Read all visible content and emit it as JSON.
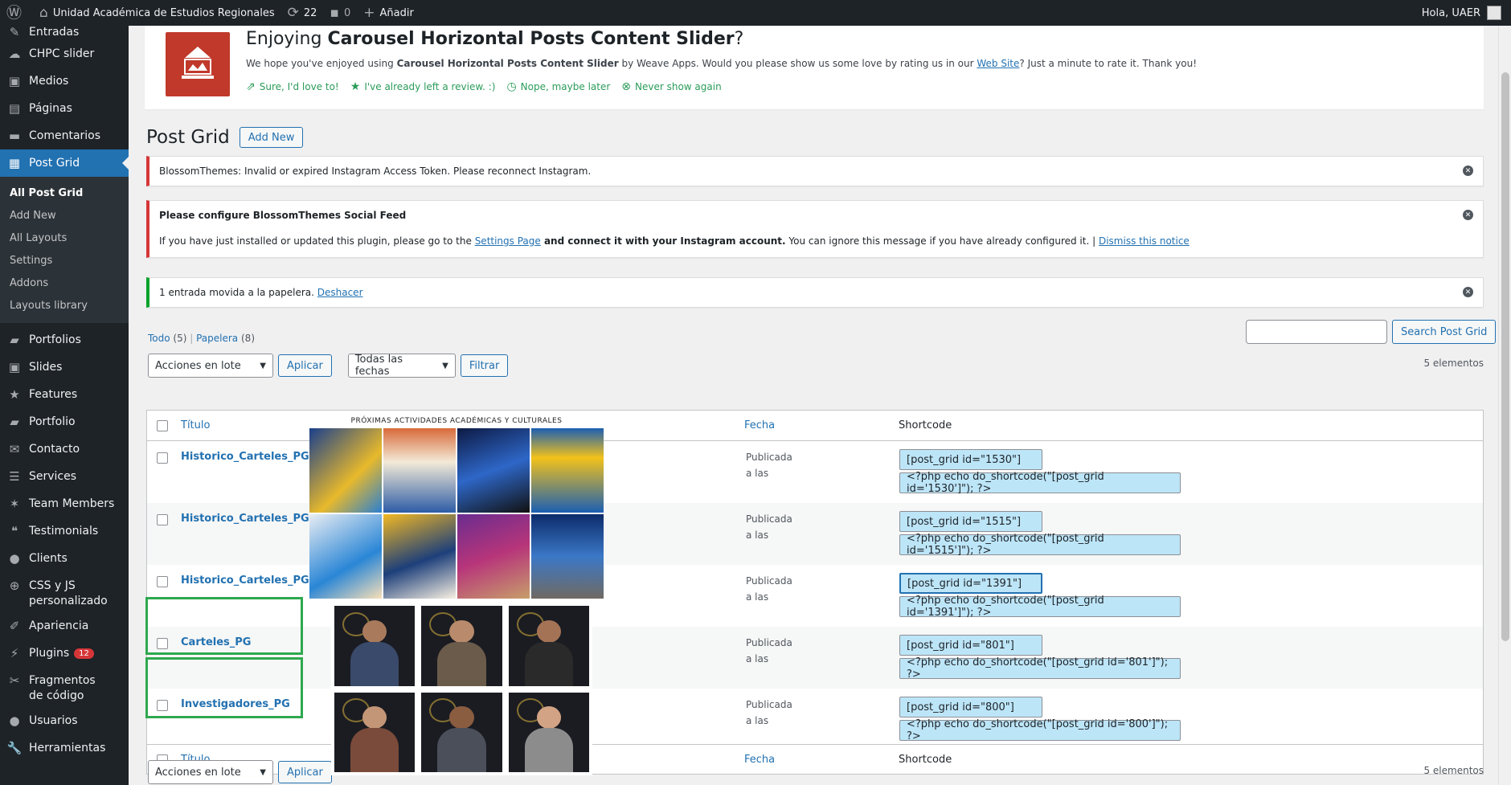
{
  "adminbar": {
    "site_name": "Unidad Académica de Estudios Regionales",
    "updates": "22",
    "comments": "0",
    "new_label": "Añadir",
    "greeting": "Hola, UAER"
  },
  "sidebar": {
    "items": [
      {
        "label": "Entradas",
        "icon": "pin-icon"
      },
      {
        "label": "CHPC slider",
        "icon": "slider-icon"
      },
      {
        "label": "Medios",
        "icon": "media-icon"
      },
      {
        "label": "Páginas",
        "icon": "pages-icon"
      },
      {
        "label": "Comentarios",
        "icon": "comment-icon"
      },
      {
        "label": "Post Grid",
        "icon": "grid-icon"
      }
    ],
    "submenu": [
      "All Post Grid",
      "Add New",
      "All Layouts",
      "Settings",
      "Addons",
      "Layouts library"
    ],
    "items2": [
      {
        "label": "Portfolios"
      },
      {
        "label": "Slides"
      },
      {
        "label": "Features"
      },
      {
        "label": "Portfolio"
      },
      {
        "label": "Contacto"
      },
      {
        "label": "Services"
      },
      {
        "label": "Team Members"
      },
      {
        "label": "Testimonials"
      },
      {
        "label": "Clients"
      },
      {
        "label": "CSS y JS personalizado"
      },
      {
        "label": "Apariencia"
      },
      {
        "label": "Plugins",
        "badge": "12"
      },
      {
        "label": "Fragmentos de código"
      },
      {
        "label": "Usuarios"
      },
      {
        "label": "Herramientas"
      }
    ]
  },
  "rate_notice": {
    "title_prefix": "Enjoying ",
    "title_bold": "Carousel Horizontal Posts Content Slider",
    "title_suffix": "?",
    "text_1": "We hope you've enjoyed using ",
    "text_bold": "Carousel Horizontal Posts Content Slider",
    "text_2": " by Weave Apps. Would you please show us some love by rating us in our ",
    "text_link": "Web Site",
    "text_3": "? Just a minute to rate it. Thank you!",
    "actions": [
      "Sure, I'd love to!",
      "I've already left a review. :)",
      "Nope, maybe later",
      "Never show again"
    ]
  },
  "page": {
    "title": "Post Grid",
    "add_new": "Add New"
  },
  "notices": {
    "n1": "BlossomThemes: Invalid or expired Instagram Access Token. Please reconnect Instagram.",
    "n2_title": "Please configure BlossomThemes Social Feed",
    "n2_a": "If you have just installed or updated this plugin, please go to the ",
    "n2_link": "Settings Page",
    "n2_b": " and connect it with your Instagram account.",
    "n2_c": " You can ignore this message if you have already configured it. | ",
    "n2_dismiss": "Dismiss this notice",
    "n3_text": "1 entrada movida a la papelera. ",
    "n3_link": "Deshacer"
  },
  "views": {
    "all": "Todo",
    "all_count": "(5)",
    "trash": "Papelera",
    "trash_count": "(8)"
  },
  "search": {
    "button": "Search Post Grid",
    "value": ""
  },
  "tablenav": {
    "bulk": "Acciones en lote",
    "apply": "Aplicar",
    "dates": "Todas las fechas",
    "filter": "Filtrar",
    "count": "5 elementos"
  },
  "table": {
    "col_title": "Título",
    "col_date": "Fecha",
    "col_shortcode": "Shortcode",
    "rows": [
      {
        "title": "Historico_Carteles_PG – 2",
        "status": "Publicada",
        "when": "a las",
        "sc": "[post_grid id=\"1530\"]",
        "php": "<?php echo do_shortcode(\"[post_grid id='1530']\"); ?>"
      },
      {
        "title": "Historico_Carteles_PG – 2",
        "status": "Publicada",
        "when": "a las",
        "sc": "[post_grid id=\"1515\"]",
        "php": "<?php echo do_shortcode(\"[post_grid id='1515']\"); ?>"
      },
      {
        "title": "Historico_Carteles_PG",
        "status": "Publicada",
        "when": "a las",
        "sc": "[post_grid id=\"1391\"]",
        "php": "<?php echo do_shortcode(\"[post_grid id='1391']\"); ?>"
      },
      {
        "title": "Carteles_PG",
        "status": "Publicada",
        "when": "a las",
        "sc": "[post_grid id=\"801\"]",
        "php": "<?php echo do_shortcode(\"[post_grid id='801']\"); ?>"
      },
      {
        "title": "Investigadores_PG",
        "status": "Publicada",
        "when": "a las",
        "sc": "[post_grid id=\"800\"]",
        "php": "<?php echo do_shortcode(\"[post_grid id='800']\"); ?>"
      }
    ]
  },
  "preview": {
    "poster_heading": "PRÓXIMAS ACTIVIDADES ACADÉMICAS Y CULTURALES"
  },
  "colors": {
    "accent": "#2271b1",
    "error": "#d63638",
    "success": "#00a32a",
    "highlight": "#2ea84e"
  }
}
